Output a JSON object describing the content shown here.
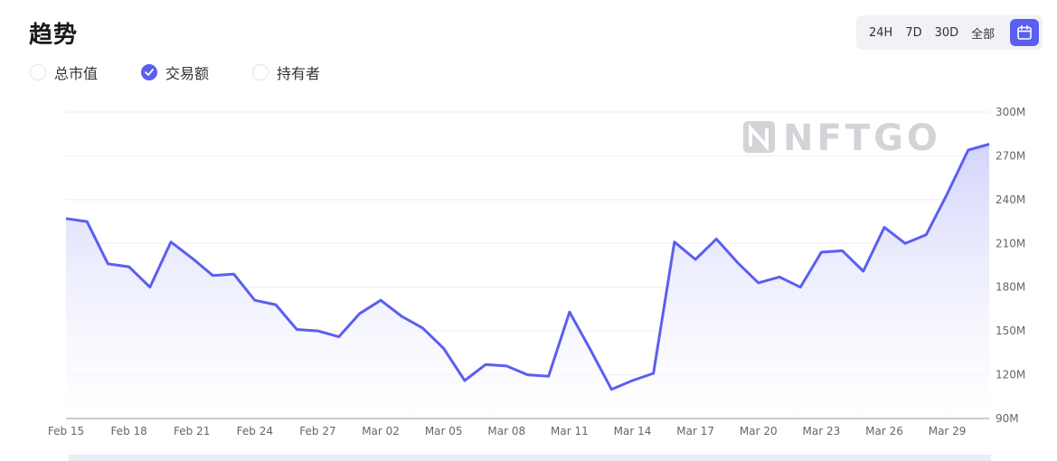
{
  "title": "趋势",
  "metrics": [
    {
      "label": "总市值",
      "selected": false
    },
    {
      "label": "交易额",
      "selected": true
    },
    {
      "label": "持有者",
      "selected": false
    }
  ],
  "range_options": [
    "24H",
    "7D",
    "30D",
    "全部"
  ],
  "watermark": "NFTGO",
  "colors": {
    "accent": "#5b5ff0",
    "area_top": "#d6d8fb"
  },
  "chart_data": {
    "type": "area",
    "title": "",
    "xlabel": "",
    "ylabel": "",
    "ylim": [
      90,
      300
    ],
    "y_unit": "M",
    "y_ticks": [
      "90M",
      "120M",
      "150M",
      "180M",
      "210M",
      "240M",
      "270M",
      "300M"
    ],
    "y_tick_values": [
      90,
      120,
      150,
      180,
      210,
      240,
      270,
      300
    ],
    "x_tick_labels": [
      "Feb 15",
      "Feb 18",
      "Feb 21",
      "Feb 24",
      "Feb 27",
      "Mar 02",
      "Mar 05",
      "Mar 08",
      "Mar 11",
      "Mar 14",
      "Mar 17",
      "Mar 20",
      "Mar 23",
      "Mar 26",
      "Mar 29"
    ],
    "grid": true,
    "series": [
      {
        "values": [
          227,
          225,
          196,
          194,
          180,
          211,
          200,
          188,
          189,
          171,
          168,
          151,
          150,
          146,
          162,
          171,
          160,
          152,
          138,
          116,
          127,
          126,
          120,
          119,
          163,
          137,
          110,
          116,
          121,
          211,
          199,
          213,
          197,
          183,
          187,
          180,
          204,
          205,
          191,
          221,
          210,
          216,
          244,
          274,
          278
        ]
      }
    ]
  }
}
